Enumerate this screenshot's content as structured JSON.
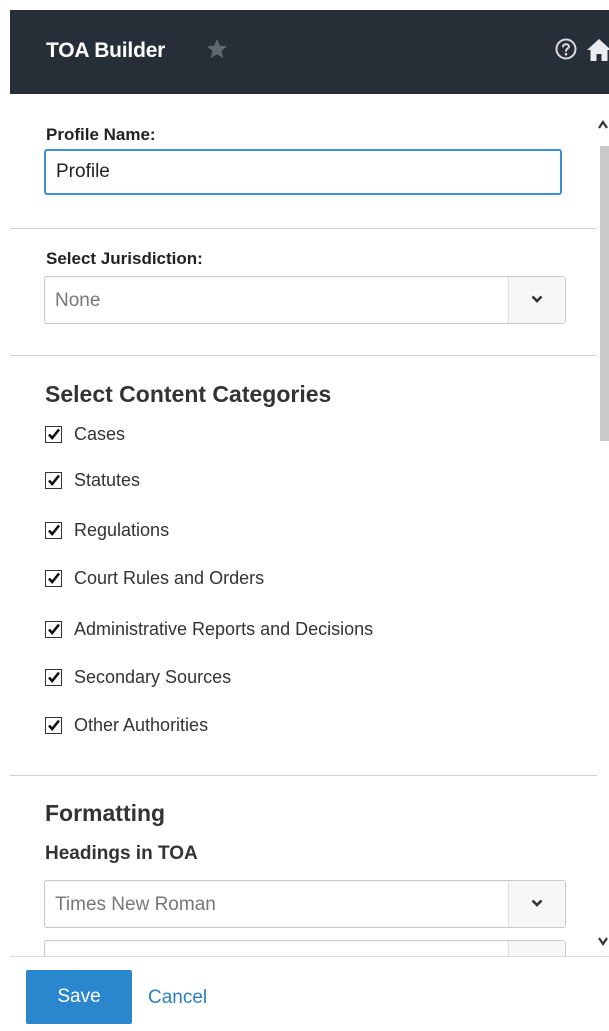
{
  "header": {
    "title": "TOA Builder",
    "favorite_icon": "star-icon",
    "help_icon": "help-circle-icon",
    "home_icon": "home-icon",
    "background_color": "#262f38"
  },
  "profile": {
    "label": "Profile Name:",
    "value": "Profile"
  },
  "jurisdiction": {
    "label": "Select Jurisdiction:",
    "selected": "None"
  },
  "categories": {
    "title": "Select Content Categories",
    "items": [
      {
        "label": "Cases",
        "checked": true
      },
      {
        "label": "Statutes",
        "checked": true
      },
      {
        "label": "Regulations",
        "checked": true
      },
      {
        "label": "Court Rules and Orders",
        "checked": true
      },
      {
        "label": "Administrative Reports and Decisions",
        "checked": true
      },
      {
        "label": "Secondary Sources",
        "checked": true
      },
      {
        "label": "Other Authorities",
        "checked": true
      }
    ]
  },
  "formatting": {
    "title": "Formatting",
    "headings_label": "Headings in TOA",
    "font_selected": "Times New Roman"
  },
  "footer": {
    "save_label": "Save",
    "cancel_label": "Cancel",
    "accent_color": "#2a87cd"
  }
}
